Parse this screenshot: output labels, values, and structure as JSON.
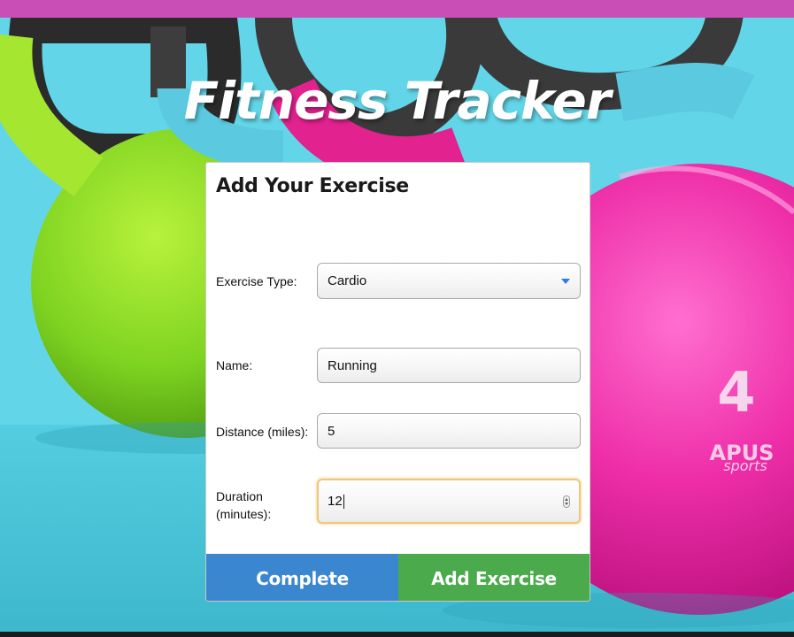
{
  "app": {
    "title": "Fitness Tracker"
  },
  "form": {
    "heading": "Add Your Exercise",
    "fields": [
      {
        "label": "Exercise Type:",
        "value": "Cardio",
        "kind": "select"
      },
      {
        "label": "Name:",
        "value": "Running",
        "kind": "text"
      },
      {
        "label": "Distance (miles):",
        "value": "5",
        "kind": "text"
      },
      {
        "label_line1": "Duration",
        "label_line2": "(minutes):",
        "value": "12",
        "kind": "number",
        "focused": true
      }
    ],
    "buttons": {
      "complete": "Complete",
      "add": "Add Exercise"
    }
  },
  "background": {
    "kettlebell_text": "4",
    "brand_name": "APUS",
    "brand_sub": "sports"
  },
  "colors": {
    "top_bar": "#c94fb7",
    "complete_button": "#3a86cf",
    "add_button": "#4aaa4c",
    "select_arrow": "#2c7be5",
    "focus_ring": "#f0c77a"
  },
  "icons": {
    "select_arrow": "triangle-down",
    "number_spinner": "up-down-arrows"
  }
}
